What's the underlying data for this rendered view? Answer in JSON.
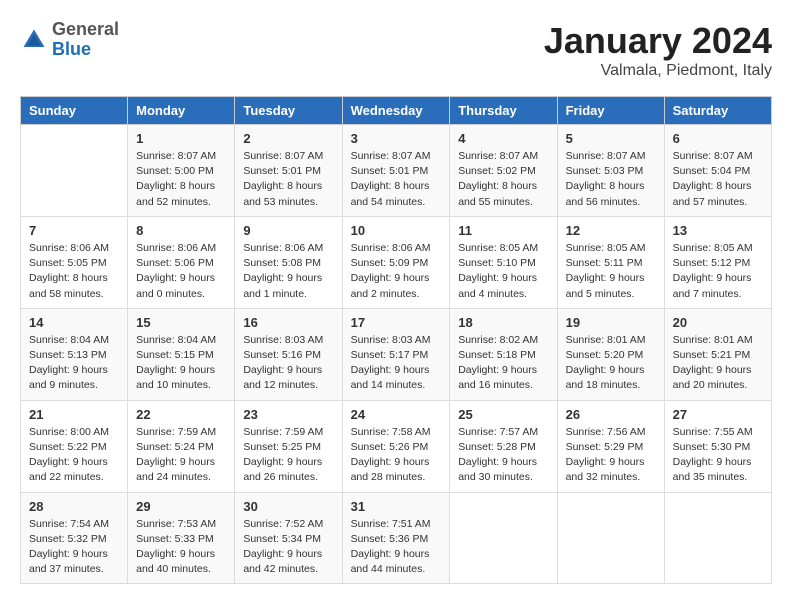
{
  "header": {
    "logo_general": "General",
    "logo_blue": "Blue",
    "month_title": "January 2024",
    "location": "Valmala, Piedmont, Italy"
  },
  "days_of_week": [
    "Sunday",
    "Monday",
    "Tuesday",
    "Wednesday",
    "Thursday",
    "Friday",
    "Saturday"
  ],
  "weeks": [
    [
      {
        "num": "",
        "info": ""
      },
      {
        "num": "1",
        "info": "Sunrise: 8:07 AM\nSunset: 5:00 PM\nDaylight: 8 hours\nand 52 minutes."
      },
      {
        "num": "2",
        "info": "Sunrise: 8:07 AM\nSunset: 5:01 PM\nDaylight: 8 hours\nand 53 minutes."
      },
      {
        "num": "3",
        "info": "Sunrise: 8:07 AM\nSunset: 5:01 PM\nDaylight: 8 hours\nand 54 minutes."
      },
      {
        "num": "4",
        "info": "Sunrise: 8:07 AM\nSunset: 5:02 PM\nDaylight: 8 hours\nand 55 minutes."
      },
      {
        "num": "5",
        "info": "Sunrise: 8:07 AM\nSunset: 5:03 PM\nDaylight: 8 hours\nand 56 minutes."
      },
      {
        "num": "6",
        "info": "Sunrise: 8:07 AM\nSunset: 5:04 PM\nDaylight: 8 hours\nand 57 minutes."
      }
    ],
    [
      {
        "num": "7",
        "info": "Sunrise: 8:06 AM\nSunset: 5:05 PM\nDaylight: 8 hours\nand 58 minutes."
      },
      {
        "num": "8",
        "info": "Sunrise: 8:06 AM\nSunset: 5:06 PM\nDaylight: 9 hours\nand 0 minutes."
      },
      {
        "num": "9",
        "info": "Sunrise: 8:06 AM\nSunset: 5:08 PM\nDaylight: 9 hours\nand 1 minute."
      },
      {
        "num": "10",
        "info": "Sunrise: 8:06 AM\nSunset: 5:09 PM\nDaylight: 9 hours\nand 2 minutes."
      },
      {
        "num": "11",
        "info": "Sunrise: 8:05 AM\nSunset: 5:10 PM\nDaylight: 9 hours\nand 4 minutes."
      },
      {
        "num": "12",
        "info": "Sunrise: 8:05 AM\nSunset: 5:11 PM\nDaylight: 9 hours\nand 5 minutes."
      },
      {
        "num": "13",
        "info": "Sunrise: 8:05 AM\nSunset: 5:12 PM\nDaylight: 9 hours\nand 7 minutes."
      }
    ],
    [
      {
        "num": "14",
        "info": "Sunrise: 8:04 AM\nSunset: 5:13 PM\nDaylight: 9 hours\nand 9 minutes."
      },
      {
        "num": "15",
        "info": "Sunrise: 8:04 AM\nSunset: 5:15 PM\nDaylight: 9 hours\nand 10 minutes."
      },
      {
        "num": "16",
        "info": "Sunrise: 8:03 AM\nSunset: 5:16 PM\nDaylight: 9 hours\nand 12 minutes."
      },
      {
        "num": "17",
        "info": "Sunrise: 8:03 AM\nSunset: 5:17 PM\nDaylight: 9 hours\nand 14 minutes."
      },
      {
        "num": "18",
        "info": "Sunrise: 8:02 AM\nSunset: 5:18 PM\nDaylight: 9 hours\nand 16 minutes."
      },
      {
        "num": "19",
        "info": "Sunrise: 8:01 AM\nSunset: 5:20 PM\nDaylight: 9 hours\nand 18 minutes."
      },
      {
        "num": "20",
        "info": "Sunrise: 8:01 AM\nSunset: 5:21 PM\nDaylight: 9 hours\nand 20 minutes."
      }
    ],
    [
      {
        "num": "21",
        "info": "Sunrise: 8:00 AM\nSunset: 5:22 PM\nDaylight: 9 hours\nand 22 minutes."
      },
      {
        "num": "22",
        "info": "Sunrise: 7:59 AM\nSunset: 5:24 PM\nDaylight: 9 hours\nand 24 minutes."
      },
      {
        "num": "23",
        "info": "Sunrise: 7:59 AM\nSunset: 5:25 PM\nDaylight: 9 hours\nand 26 minutes."
      },
      {
        "num": "24",
        "info": "Sunrise: 7:58 AM\nSunset: 5:26 PM\nDaylight: 9 hours\nand 28 minutes."
      },
      {
        "num": "25",
        "info": "Sunrise: 7:57 AM\nSunset: 5:28 PM\nDaylight: 9 hours\nand 30 minutes."
      },
      {
        "num": "26",
        "info": "Sunrise: 7:56 AM\nSunset: 5:29 PM\nDaylight: 9 hours\nand 32 minutes."
      },
      {
        "num": "27",
        "info": "Sunrise: 7:55 AM\nSunset: 5:30 PM\nDaylight: 9 hours\nand 35 minutes."
      }
    ],
    [
      {
        "num": "28",
        "info": "Sunrise: 7:54 AM\nSunset: 5:32 PM\nDaylight: 9 hours\nand 37 minutes."
      },
      {
        "num": "29",
        "info": "Sunrise: 7:53 AM\nSunset: 5:33 PM\nDaylight: 9 hours\nand 40 minutes."
      },
      {
        "num": "30",
        "info": "Sunrise: 7:52 AM\nSunset: 5:34 PM\nDaylight: 9 hours\nand 42 minutes."
      },
      {
        "num": "31",
        "info": "Sunrise: 7:51 AM\nSunset: 5:36 PM\nDaylight: 9 hours\nand 44 minutes."
      },
      {
        "num": "",
        "info": ""
      },
      {
        "num": "",
        "info": ""
      },
      {
        "num": "",
        "info": ""
      }
    ]
  ]
}
